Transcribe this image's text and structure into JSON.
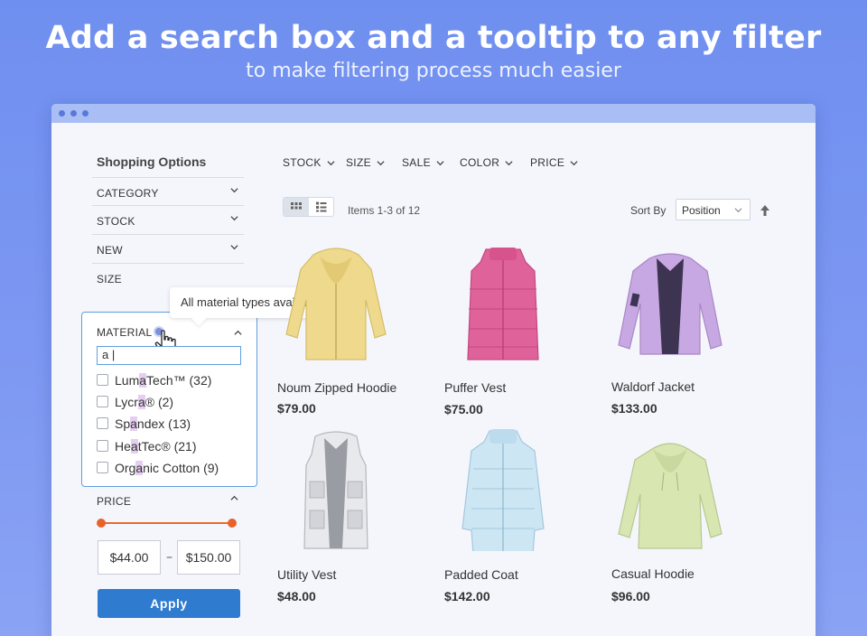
{
  "banner": {
    "headline": "Add a search box and a tooltip to any filter",
    "subline": "to make filtering process much easier"
  },
  "sidebar": {
    "title": "Shopping Options",
    "facets": [
      "CATEGORY",
      "STOCK",
      "NEW",
      "SIZE"
    ],
    "material": {
      "label": "MATERIAL",
      "tooltip": "All material types availlable",
      "search_value": "a",
      "options": [
        {
          "pre": "Lum",
          "hl": "a",
          "post": "Tech™ (32)"
        },
        {
          "pre": "Lycr",
          "hl": "a",
          "post": "® (2)"
        },
        {
          "pre": "Sp",
          "hl": "a",
          "post": "ndex (13)"
        },
        {
          "pre": "He",
          "hl": "a",
          "post": "tTec® (21)"
        },
        {
          "pre": "Org",
          "hl": "a",
          "post": "nic Cotton (9)"
        }
      ]
    },
    "price": {
      "label": "PRICE",
      "min": "$44.00",
      "dash": "–",
      "max": "$150.00",
      "apply_label": "Apply"
    }
  },
  "toolbar": {
    "filters": [
      "STOCK",
      "SIZE",
      "SALE",
      "COLOR",
      "PRICE"
    ],
    "items_count": "Items 1-3 of 12",
    "sort_by_label": "Sort By",
    "sort_value": "Position"
  },
  "products": [
    {
      "name": "Noum Zipped Hoodie",
      "price": "$79.00",
      "icon": "yellow-hoodie-image",
      "color": "#efd98c"
    },
    {
      "name": "Puffer Vest",
      "price": "$75.00",
      "icon": "pink-vest-image",
      "color": "#e0629a"
    },
    {
      "name": "Waldorf Jacket",
      "price": "$133.00",
      "icon": "lavender-jacket-image",
      "color": "#c8a8e2"
    },
    {
      "name": "Utility Vest",
      "price": "$48.00",
      "icon": "white-vest-image",
      "color": "#dfe0e4"
    },
    {
      "name": "Padded Coat",
      "price": "$142.00",
      "icon": "lightblue-coat-image",
      "color": "#cde6f4"
    },
    {
      "name": "Casual Hoodie",
      "price": "$96.00",
      "icon": "green-hoodie-image",
      "color": "#d8e6b2"
    }
  ],
  "colors": {
    "accent_blue": "#2e7bd0",
    "slider_orange": "#e8632a",
    "highlight_purple": "#e6cdf2",
    "focus_border": "#5f9fe0"
  }
}
